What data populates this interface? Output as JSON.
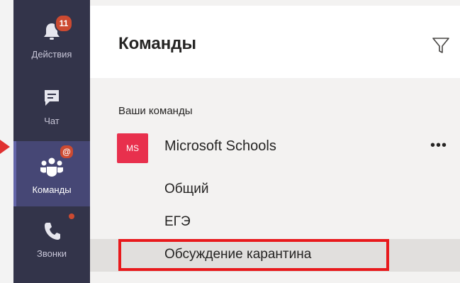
{
  "rail": {
    "items": [
      {
        "label": "Действия",
        "icon": "bell-icon",
        "badge": "11"
      },
      {
        "label": "Чат",
        "icon": "chat-icon"
      },
      {
        "label": "Команды",
        "icon": "teams-icon",
        "badge": "@",
        "active": true
      },
      {
        "label": "Звонки",
        "icon": "phone-icon",
        "dot": true
      }
    ]
  },
  "panel": {
    "title": "Команды",
    "filter_icon": "filter-icon",
    "section_label": "Ваши команды",
    "team": {
      "avatar": "MS",
      "name": "Microsoft Schools",
      "more": "•••",
      "channels": [
        "Общий",
        "ЕГЭ",
        "Обсуждение карантина"
      ],
      "selected_channel": "Обсуждение карантина"
    }
  },
  "colors": {
    "rail_bg": "#33344a",
    "rail_active": "#464775",
    "badge": "#cc4a31",
    "team_avatar": "#e8304d",
    "annotation_red": "#e8191c"
  }
}
